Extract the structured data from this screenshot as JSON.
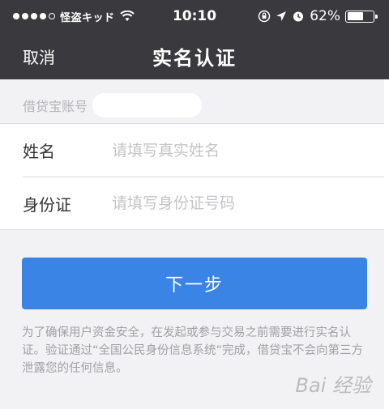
{
  "status_bar": {
    "carrier": "怪盗キッド",
    "time": "10:10",
    "battery_percent": "62%",
    "battery_level": 0.62
  },
  "nav": {
    "cancel_label": "取消",
    "title": "实名认证"
  },
  "account": {
    "label": "借贷宝账号"
  },
  "form": {
    "name_label": "姓名",
    "name_placeholder": "请填写真实姓名",
    "id_label": "身份证",
    "id_placeholder": "请填写身份证号码"
  },
  "next_button_label": "下一步",
  "notice": "为了确保用户资金安全，在发起或参与交易之前需要进行实名认证。验证通过“全国公民身份信息系统”完成，借贷宝不会向第三方泄露您的任何信息。",
  "watermark": "Bai 经验",
  "colors": {
    "nav_background": "#3a3a3e",
    "primary_button": "#3a84e6"
  }
}
